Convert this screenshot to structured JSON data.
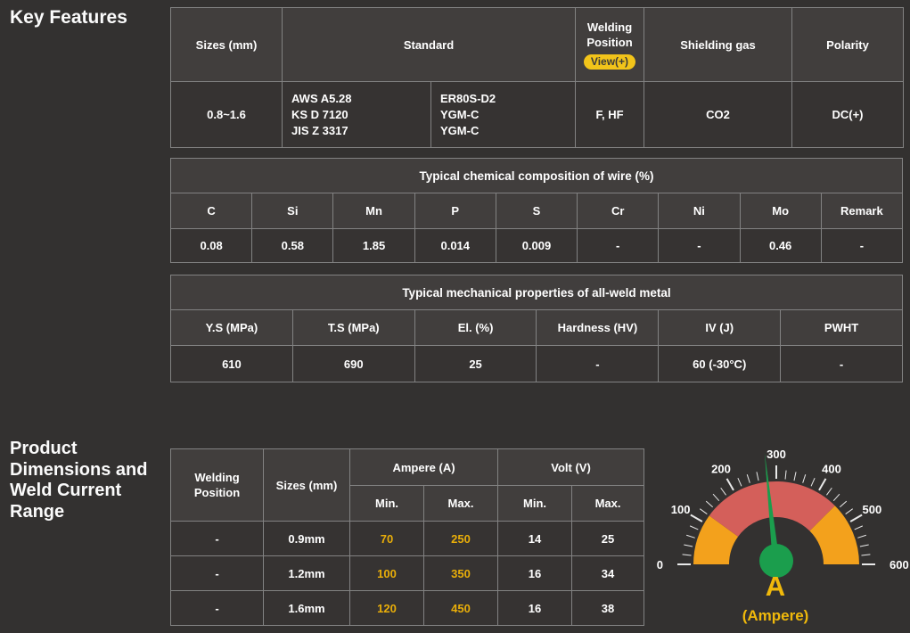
{
  "key_features": {
    "heading": "Key Features",
    "spec_table": {
      "col_sizes": "Sizes (mm)",
      "col_standard": "Standard",
      "col_welding_position": "Welding Position",
      "view_button": "View(+)",
      "col_shielding_gas": "Shielding gas",
      "col_polarity": "Polarity",
      "sizes_value": "0.8~1.6",
      "standard_specs": [
        "AWS A5.28",
        "KS D 7120",
        "JIS Z 3317"
      ],
      "standard_grades": [
        "ER80S-D2",
        "YGM-C",
        "YGM-C"
      ],
      "welding_position_value": "F, HF",
      "shielding_gas_value": "CO2",
      "polarity_value": "DC(+)"
    },
    "chemical_table": {
      "title": "Typical chemical composition of wire (%)",
      "headers": [
        "C",
        "Si",
        "Mn",
        "P",
        "S",
        "Cr",
        "Ni",
        "Mo",
        "Remark"
      ],
      "values": [
        "0.08",
        "0.58",
        "1.85",
        "0.014",
        "0.009",
        "-",
        "-",
        "0.46",
        "-"
      ]
    },
    "mechanical_table": {
      "title": "Typical mechanical properties of all-weld metal",
      "headers": [
        "Y.S (MPa)",
        "T.S (MPa)",
        "El. (%)",
        "Hardness (HV)",
        "IV (J)",
        "PWHT"
      ],
      "values": [
        "610",
        "690",
        "25",
        "-",
        "60 (-30°C)",
        "-"
      ]
    }
  },
  "product_dimensions": {
    "heading": "Product Dimensions and Weld Current Range",
    "current_table": {
      "col_welding_position": "Welding Position",
      "col_sizes": "Sizes (mm)",
      "col_ampere": "Ampere (A)",
      "col_volt": "Volt (V)",
      "min_label": "Min.",
      "max_label": "Max.",
      "rows": [
        {
          "welding_position": "-",
          "size": "0.9mm",
          "amp_min": "70",
          "amp_max": "250",
          "volt_min": "14",
          "volt_max": "25"
        },
        {
          "welding_position": "-",
          "size": "1.2mm",
          "amp_min": "100",
          "amp_max": "350",
          "volt_min": "16",
          "volt_max": "34"
        },
        {
          "welding_position": "-",
          "size": "1.6mm",
          "amp_min": "120",
          "amp_max": "450",
          "volt_min": "16",
          "volt_max": "38"
        }
      ]
    }
  },
  "chart_data": {
    "type": "gauge",
    "min": 0,
    "max": 600,
    "tick_labels": [
      0,
      100,
      200,
      300,
      400,
      500,
      600
    ],
    "minor_tick_step": 20,
    "segments": [
      {
        "from": 0,
        "to": 120,
        "color": "#f3a11c"
      },
      {
        "from": 120,
        "to": 450,
        "color": "#d45f5a"
      },
      {
        "from": 450,
        "to": 600,
        "color": "#f3a11c"
      }
    ],
    "needle_value": 280,
    "needle_color": "#1b9e4d",
    "tick_color": "#e9e9e9",
    "label_color": "#ffffff",
    "unit": "A",
    "unit_caption": "(Ampere)"
  }
}
